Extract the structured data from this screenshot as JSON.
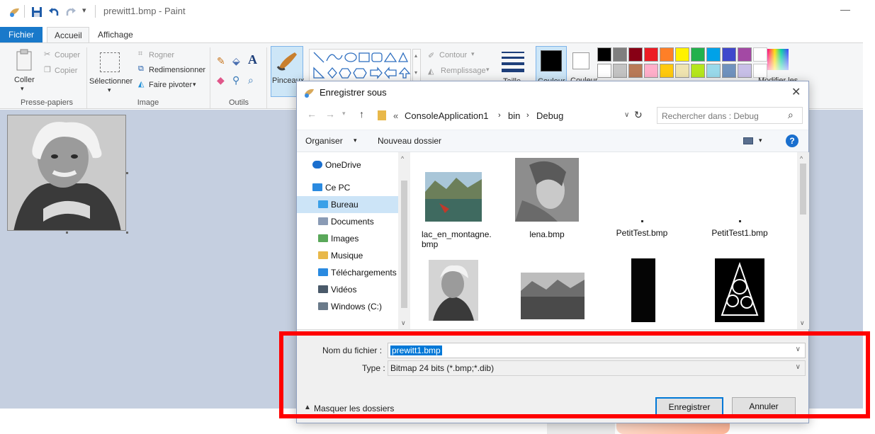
{
  "window": {
    "title": "prewitt1.bmp - Paint"
  },
  "tabs": [
    {
      "label": "Fichier"
    },
    {
      "label": "Accueil"
    },
    {
      "label": "Affichage"
    }
  ],
  "ribbon": {
    "clipboard": {
      "label": "Presse-papiers",
      "paste": "Coller",
      "cut": "Couper",
      "copy": "Copier"
    },
    "image": {
      "label": "Image",
      "select": "Sélectionner",
      "crop": "Rogner",
      "resize": "Redimensionner",
      "rotate": "Faire pivoter"
    },
    "tools": {
      "label": "Outils",
      "brushes": "Pinceaux"
    },
    "shapes": {
      "outline": "Contour",
      "fill": "Remplissage"
    },
    "size": "Taille",
    "color1": "Couleur",
    "color2": "Couleur",
    "edit_colors": "Modifier les",
    "palette_top": [
      "#000000",
      "#7f7f7f",
      "#880015",
      "#ed1c24",
      "#ff7f27",
      "#fff200",
      "#22b14c",
      "#00a2e8",
      "#3f48cc",
      "#a349a4"
    ],
    "palette_bottom": [
      "#ffffff",
      "#c3c3c3",
      "#b97a57",
      "#ffaec9",
      "#ffc90e",
      "#efe4b0",
      "#b5e61d",
      "#99d9ea",
      "#7092be",
      "#c8bfe7"
    ]
  },
  "dialog": {
    "title": "Enregistrer sous",
    "breadcrumb": [
      "«",
      "ConsoleApplication1",
      "bin",
      "Debug"
    ],
    "search_placeholder": "Rechercher dans : Debug",
    "toolbar": {
      "organize": "Organiser",
      "new_folder": "Nouveau dossier"
    },
    "nav": [
      {
        "label": "OneDrive",
        "icon": "onedrive-icon"
      },
      {
        "label": "Ce PC",
        "icon": "pc-icon"
      },
      {
        "label": "Bureau",
        "icon": "folder-icon",
        "selected": true
      },
      {
        "label": "Documents",
        "icon": "documents-icon"
      },
      {
        "label": "Images",
        "icon": "images-icon"
      },
      {
        "label": "Musique",
        "icon": "music-icon"
      },
      {
        "label": "Téléchargements",
        "icon": "downloads-icon"
      },
      {
        "label": "Vidéos",
        "icon": "videos-icon"
      },
      {
        "label": "Windows (C:)",
        "icon": "drive-icon"
      }
    ],
    "files_row1": [
      {
        "name": "lac_en_montagne.bmp",
        "line1": "lac_en_montagne.",
        "line2": "bmp"
      },
      {
        "name": "lena.bmp",
        "line1": "lena.bmp",
        "line2": ""
      },
      {
        "name": "PetitTest.bmp",
        "line1": "PetitTest.bmp",
        "line2": ""
      },
      {
        "name": "PetitTest1.bmp",
        "line1": "PetitTest1.bmp",
        "line2": ""
      }
    ],
    "filename_label": "Nom du fichier :",
    "filename_value": "prewitt1.bmp",
    "type_label": "Type :",
    "type_value": "Bitmap 24 bits (*.bmp;*.dib)",
    "hide_folders": "Masquer les dossiers",
    "save_button": "Enregistrer",
    "cancel_button": "Annuler"
  }
}
